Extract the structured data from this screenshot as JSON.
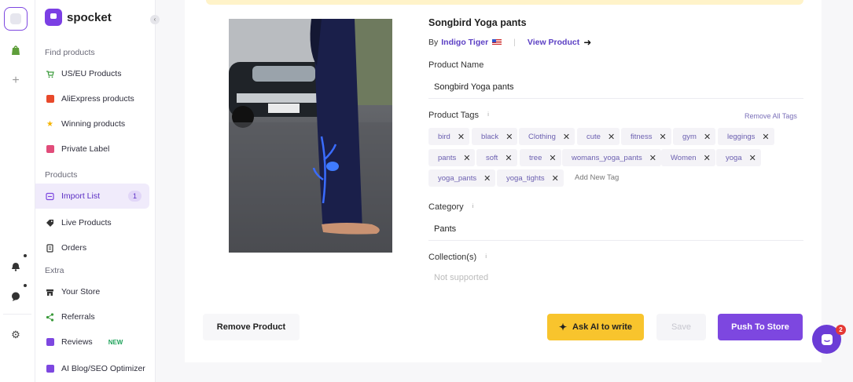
{
  "brand": {
    "name": "spocket",
    "accent": "#7d47e0"
  },
  "sidebar": {
    "sections": [
      {
        "label": "Find products"
      },
      {
        "label": "Products"
      },
      {
        "label": "Extra"
      }
    ],
    "items": [
      {
        "label": "US/EU Products",
        "icon": "cart-icon"
      },
      {
        "label": "AliExpress products",
        "icon": "aliexpress-icon"
      },
      {
        "label": "Winning products",
        "icon": "star-icon"
      },
      {
        "label": "Private Label",
        "icon": "label-icon"
      },
      {
        "label": "Import List",
        "icon": "import-icon",
        "badge": "1",
        "active": true
      },
      {
        "label": "Live Products",
        "icon": "tag-icon"
      },
      {
        "label": "Orders",
        "icon": "orders-icon"
      },
      {
        "label": "Your Store",
        "icon": "store-icon"
      },
      {
        "label": "Referrals",
        "icon": "share-icon"
      },
      {
        "label": "Reviews",
        "icon": "reviews-icon",
        "new": "NEW"
      },
      {
        "label": "AI Blog/SEO Optimizer",
        "icon": "ai-icon"
      }
    ]
  },
  "product": {
    "title": "Songbird Yoga pants",
    "by": "By",
    "seller": "Indigo Tiger",
    "view_product": "View Product",
    "name_label": "Product Name",
    "name_value": "Songbird Yoga pants",
    "tags_label": "Product Tags",
    "remove_all_tags": "Remove All Tags",
    "tags": [
      "bird",
      "black",
      "Clothing",
      "cute",
      "fitness",
      "gym",
      "leggings",
      "pants",
      "soft",
      "tree",
      "womans_yoga_pants",
      "Women",
      "yoga",
      "yoga_pants",
      "yoga_tights"
    ],
    "add_tag_placeholder": "Add New Tag",
    "category_label": "Category",
    "category_value": "Pants",
    "collections_label": "Collection(s)",
    "collections_value": "Not supported"
  },
  "actions": {
    "remove": "Remove Product",
    "ask_ai": "Ask AI to write",
    "save": "Save",
    "push": "Push To Store"
  },
  "chat": {
    "unread": "2"
  }
}
